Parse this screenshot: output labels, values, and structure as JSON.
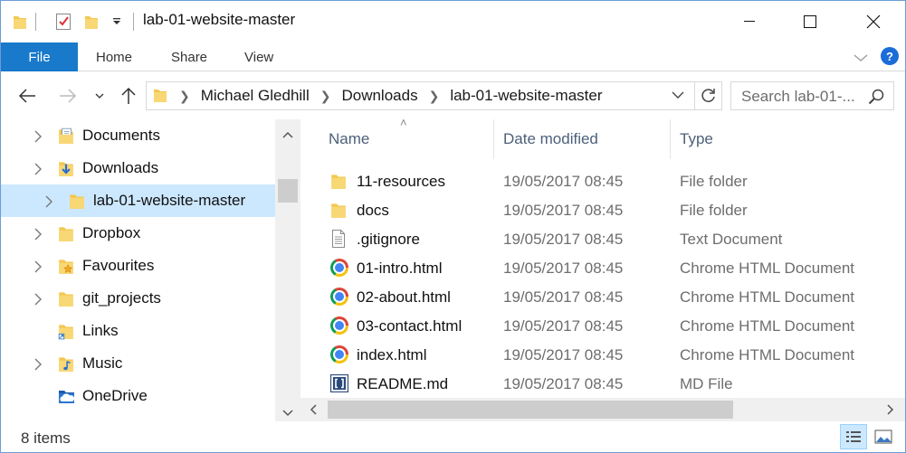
{
  "window": {
    "title": "lab-01-website-master"
  },
  "ribbon": {
    "tabs": [
      "File",
      "Home",
      "Share",
      "View"
    ],
    "help_label": "?"
  },
  "address": {
    "crumbs": [
      "Michael Gledhill",
      "Downloads",
      "lab-01-website-master"
    ]
  },
  "search": {
    "placeholder": "Search lab-01-..."
  },
  "nav": {
    "items": [
      {
        "label": "Documents",
        "expandable": true,
        "icon": "documents-folder-icon"
      },
      {
        "label": "Downloads",
        "expandable": true,
        "icon": "downloads-folder-icon"
      },
      {
        "label": "lab-01-website-master",
        "expandable": true,
        "icon": "folder-icon",
        "selected": true,
        "indent": true
      },
      {
        "label": "Dropbox",
        "expandable": true,
        "icon": "folder-icon"
      },
      {
        "label": "Favourites",
        "expandable": true,
        "icon": "favourites-folder-icon"
      },
      {
        "label": "git_projects",
        "expandable": true,
        "icon": "folder-icon"
      },
      {
        "label": "Links",
        "expandable": false,
        "icon": "links-folder-icon"
      },
      {
        "label": "Music",
        "expandable": true,
        "icon": "music-folder-icon"
      },
      {
        "label": "OneDrive",
        "expandable": false,
        "icon": "onedrive-icon"
      }
    ]
  },
  "list": {
    "columns": {
      "name": "Name",
      "date": "Date modified",
      "type": "Type"
    },
    "files": [
      {
        "name": "11-resources",
        "date": "19/05/2017 08:45",
        "type": "File folder",
        "icon": "folder-icon"
      },
      {
        "name": "docs",
        "date": "19/05/2017 08:45",
        "type": "File folder",
        "icon": "folder-icon"
      },
      {
        "name": ".gitignore",
        "date": "19/05/2017 08:45",
        "type": "Text Document",
        "icon": "text-file-icon"
      },
      {
        "name": "01-intro.html",
        "date": "19/05/2017 08:45",
        "type": "Chrome HTML Document",
        "icon": "chrome-icon"
      },
      {
        "name": "02-about.html",
        "date": "19/05/2017 08:45",
        "type": "Chrome HTML Document",
        "icon": "chrome-icon"
      },
      {
        "name": "03-contact.html",
        "date": "19/05/2017 08:45",
        "type": "Chrome HTML Document",
        "icon": "chrome-icon"
      },
      {
        "name": "index.html",
        "date": "19/05/2017 08:45",
        "type": "Chrome HTML Document",
        "icon": "chrome-icon"
      },
      {
        "name": "README.md",
        "date": "19/05/2017 08:45",
        "type": "MD File",
        "icon": "brackets-file-icon"
      }
    ]
  },
  "status": {
    "item_count": "8 items"
  },
  "colors": {
    "accent": "#1979ca",
    "selection": "#cce8ff",
    "folder": "#f8d775"
  }
}
